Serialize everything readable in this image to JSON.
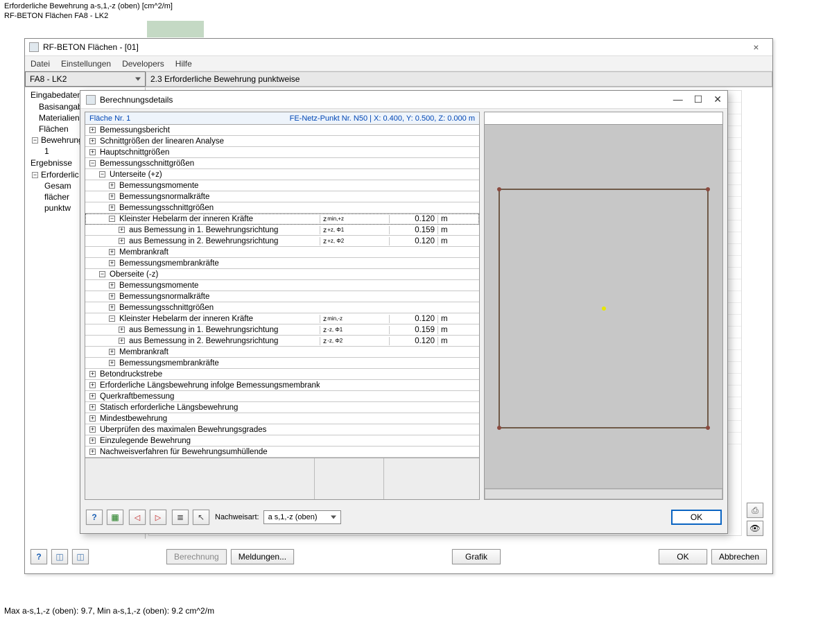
{
  "header_line1": "Erforderliche Bewehrung a-s,1,-z (oben) [cm^2/m]",
  "header_line2": "RF-BETON Flächen FA8 - LK2",
  "main_window": {
    "title": "RF-BETON Flächen - [01]",
    "close": "×"
  },
  "menu": {
    "datei": "Datei",
    "einstellungen": "Einstellungen",
    "developers": "Developers",
    "hilfe": "Hilfe"
  },
  "case_select": "FA8 - LK2",
  "case_label": "2.3 Erforderliche Bewehrung punktweise",
  "sidebar": {
    "eingabedaten": "Eingabedaten",
    "basisangab": "Basisangab",
    "materialien": "Materialien",
    "flaechen": "Flächen",
    "bewehrung": "Bewehrung",
    "eins": "1",
    "ergebnisse": "Ergebnisse",
    "erforderlic": "Erforderlic",
    "gesam": "Gesam",
    "flaecher": "flächer",
    "punktw": "punktw"
  },
  "dialog": {
    "title": "Berechnungsdetails",
    "minimize": "—",
    "maximize": "☐",
    "close": "✕",
    "header_left": "Fläche Nr. 1",
    "header_right": "FE-Netz-Punkt Nr. N50  |  X: 0.400, Y: 0.500, Z: 0.000 m",
    "rows": [
      {
        "indent": 0,
        "exp": "+",
        "label": "Bemessungsbericht"
      },
      {
        "indent": 0,
        "exp": "+",
        "label": "Schnittgrößen der linearen Analyse"
      },
      {
        "indent": 0,
        "exp": "+",
        "label": "Hauptschnittgrößen"
      },
      {
        "indent": 0,
        "exp": "−",
        "label": "Bemessungsschnittgrößen"
      },
      {
        "indent": 1,
        "exp": "−",
        "label": "Unterseite (+z)"
      },
      {
        "indent": 2,
        "exp": "+",
        "label": "Bemessungsmomente"
      },
      {
        "indent": 2,
        "exp": "+",
        "label": "Bemessungsnormalkräfte"
      },
      {
        "indent": 2,
        "exp": "+",
        "label": "Bemessungsschnittgrößen"
      },
      {
        "indent": 2,
        "exp": "−",
        "label": "Kleinster Hebelarm der inneren Kräfte",
        "dotted": true,
        "sym": "z min,+z",
        "val": "0.120",
        "unit": "m"
      },
      {
        "indent": 3,
        "exp": "+",
        "label": "aus Bemessung in 1. Bewehrungsrichtung",
        "sym": "z +z, Φ1",
        "val": "0.159",
        "unit": "m"
      },
      {
        "indent": 3,
        "exp": "+",
        "label": "aus Bemessung in 2. Bewehrungsrichtung",
        "sym": "z +z, Φ2",
        "val": "0.120",
        "unit": "m"
      },
      {
        "indent": 2,
        "exp": "+",
        "label": "Membrankraft"
      },
      {
        "indent": 2,
        "exp": "+",
        "label": "Bemessungsmembrankräfte"
      },
      {
        "indent": 1,
        "exp": "−",
        "label": "Oberseite (-z)"
      },
      {
        "indent": 2,
        "exp": "+",
        "label": "Bemessungsmomente"
      },
      {
        "indent": 2,
        "exp": "+",
        "label": "Bemessungsnormalkräfte"
      },
      {
        "indent": 2,
        "exp": "+",
        "label": "Bemessungsschnittgrößen"
      },
      {
        "indent": 2,
        "exp": "−",
        "label": "Kleinster Hebelarm der inneren Kräfte",
        "sym": "z min,-z",
        "val": "0.120",
        "unit": "m"
      },
      {
        "indent": 3,
        "exp": "+",
        "label": "aus Bemessung in 1. Bewehrungsrichtung",
        "sym": "z -z, Φ1",
        "val": "0.159",
        "unit": "m"
      },
      {
        "indent": 3,
        "exp": "+",
        "label": "aus Bemessung in 2. Bewehrungsrichtung",
        "sym": "z -z, Φ2",
        "val": "0.120",
        "unit": "m"
      },
      {
        "indent": 2,
        "exp": "+",
        "label": "Membrankraft"
      },
      {
        "indent": 2,
        "exp": "+",
        "label": "Bemessungsmembrankräfte"
      },
      {
        "indent": 0,
        "exp": "+",
        "label": "Betondruckstrebe"
      },
      {
        "indent": 0,
        "exp": "+",
        "label": "Erforderliche Längsbewehrung infolge Bemessungsmembrankräfte"
      },
      {
        "indent": 0,
        "exp": "+",
        "label": "Querkraftbemessung"
      },
      {
        "indent": 0,
        "exp": "+",
        "label": "Statisch erforderliche Längsbewehrung"
      },
      {
        "indent": 0,
        "exp": "+",
        "label": "Mindestbewehrung"
      },
      {
        "indent": 0,
        "exp": "+",
        "label": "Überprüfen des maximalen Bewehrungsgrades"
      },
      {
        "indent": 0,
        "exp": "+",
        "label": "Einzulegende Bewehrung"
      },
      {
        "indent": 0,
        "exp": "+",
        "label": "Nachweisverfahren für Bewehrungsumhüllende"
      }
    ],
    "nachweisart_label": "Nachweisart:",
    "nachweisart_value": "a s,1,-z (oben)",
    "ok": "OK"
  },
  "main_footer": {
    "berechnung": "Berechnung",
    "meldungen": "Meldungen...",
    "grafik": "Grafik",
    "ok": "OK",
    "abbrechen": "Abbrechen"
  },
  "bottom_text": "Max a-s,1,-z (oben): 9.7, Min a-s,1,-z (oben): 9.2 cm^2/m"
}
